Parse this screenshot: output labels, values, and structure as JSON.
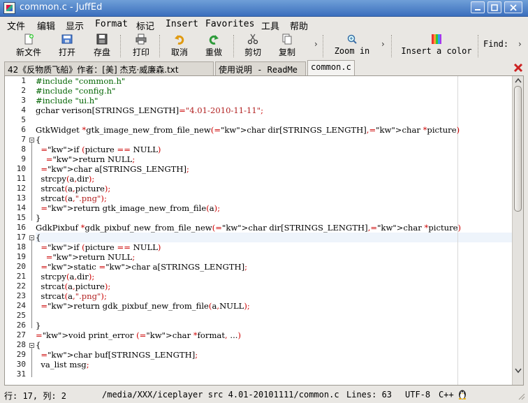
{
  "window": {
    "title": "common.c - JuffEd"
  },
  "menu": [
    "文件",
    "编辑",
    "显示",
    "Format",
    "标记",
    "Insert",
    "Favorites",
    "工具",
    "帮助"
  ],
  "toolbar": {
    "new_label": "新文件",
    "open_label": "打开",
    "save_label": "存盘",
    "print_label": "打印",
    "undo_label": "取消",
    "redo_label": "重做",
    "cut_label": "剪切",
    "copy_label": "复制",
    "zoom_label": "Zoom in",
    "color_label": "Insert a color",
    "find_label": "Find:",
    "more_glyph": "›",
    "colors": {
      "redo": "#2e9b3a",
      "undo": "#e09a10",
      "close": "#cc2222"
    }
  },
  "tabs": [
    {
      "label": "42《反物质飞船》作者：[美] 杰克·威廉森.txt"
    },
    {
      "label": "使用说明 - ReadMe"
    },
    {
      "label": "common.c"
    }
  ],
  "editor": {
    "current_line": 17,
    "lines": [
      {
        "n": "1",
        "t": "#include \"common.h\""
      },
      {
        "n": "2",
        "t": "#include \"config.h\""
      },
      {
        "n": "3",
        "t": "#include \"ui.h\""
      },
      {
        "n": "4",
        "t": "gchar verison[STRINGS_LENGTH]=\"4.01-2010-11-11\";"
      },
      {
        "n": "5",
        "t": ""
      },
      {
        "n": "6",
        "t": "GtkWidget *gtk_image_new_from_file_new(char dir[STRINGS_LENGTH],char *picture)"
      },
      {
        "n": "7",
        "t": "{"
      },
      {
        "n": "8",
        "t": "  if (picture == NULL)"
      },
      {
        "n": "9",
        "t": "    return NULL;"
      },
      {
        "n": "10",
        "t": "  char a[STRINGS_LENGTH];"
      },
      {
        "n": "11",
        "t": "  strcpy(a,dir);"
      },
      {
        "n": "12",
        "t": "  strcat(a,picture);"
      },
      {
        "n": "13",
        "t": "  strcat(a,\".png\");"
      },
      {
        "n": "14",
        "t": "  return gtk_image_new_from_file(a);"
      },
      {
        "n": "15",
        "t": "}"
      },
      {
        "n": "16",
        "t": "GdkPixbuf *gdk_pixbuf_new_from_file_new(char dir[STRINGS_LENGTH],char *picture)"
      },
      {
        "n": "17",
        "t": "{"
      },
      {
        "n": "18",
        "t": "  if (picture == NULL)"
      },
      {
        "n": "19",
        "t": "    return NULL;"
      },
      {
        "n": "20",
        "t": "  static char a[STRINGS_LENGTH];"
      },
      {
        "n": "21",
        "t": "  strcpy(a,dir);"
      },
      {
        "n": "22",
        "t": "  strcat(a,picture);"
      },
      {
        "n": "23",
        "t": "  strcat(a,\".png\");"
      },
      {
        "n": "24",
        "t": "  return gdk_pixbuf_new_from_file(a,NULL);"
      },
      {
        "n": "25",
        "t": ""
      },
      {
        "n": "26",
        "t": "}"
      },
      {
        "n": "27",
        "t": "void print_error (char *format, ...)"
      },
      {
        "n": "28",
        "t": "{"
      },
      {
        "n": "29",
        "t": "  char buf[STRINGS_LENGTH];"
      },
      {
        "n": "30",
        "t": "  va_list msg;"
      },
      {
        "n": "31",
        "t": ""
      }
    ]
  },
  "status": {
    "position": "行: 17, 列: 2",
    "path": "/media/XXX/iceplayer src 4.01-20101111/common.c",
    "lines": "Lines: 63",
    "encoding": "UTF-8",
    "syntax": "C++"
  }
}
